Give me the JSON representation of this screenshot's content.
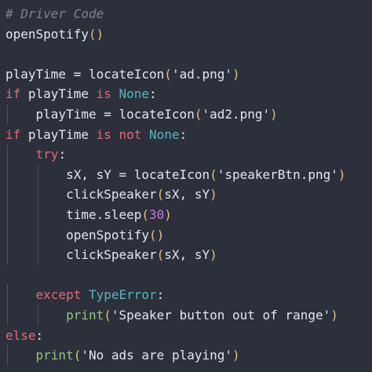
{
  "editor": {
    "lines": [
      [
        {
          "t": "# Driver Code",
          "c": "cm"
        }
      ],
      [
        {
          "t": "openSpotify",
          "c": "pu"
        },
        {
          "t": "()",
          "c": "yl"
        }
      ],
      [],
      [
        {
          "t": "playTime = locateIcon",
          "c": "pu"
        },
        {
          "t": "(",
          "c": "yl"
        },
        {
          "t": "'ad.png'",
          "c": "st"
        },
        {
          "t": ")",
          "c": "yl"
        }
      ],
      [
        {
          "t": "if",
          "c": "kw"
        },
        {
          "t": " playTime ",
          "c": "pu"
        },
        {
          "t": "is",
          "c": "kw"
        },
        {
          "t": " ",
          "c": "pu"
        },
        {
          "t": "None",
          "c": "bi"
        },
        {
          "t": ":",
          "c": "pu"
        }
      ],
      [
        {
          "t": "    playTime = locateIcon",
          "c": "pu"
        },
        {
          "t": "(",
          "c": "yl"
        },
        {
          "t": "'ad2.png'",
          "c": "st"
        },
        {
          "t": ")",
          "c": "yl"
        }
      ],
      [
        {
          "t": "if",
          "c": "kw"
        },
        {
          "t": " playTime ",
          "c": "pu"
        },
        {
          "t": "is not",
          "c": "kw"
        },
        {
          "t": " ",
          "c": "pu"
        },
        {
          "t": "None",
          "c": "bi"
        },
        {
          "t": ":",
          "c": "pu"
        }
      ],
      [
        {
          "t": "    try",
          "c": "kw"
        },
        {
          "t": ":",
          "c": "pu"
        }
      ],
      [
        {
          "t": "        sX, sY = locateIcon",
          "c": "pu"
        },
        {
          "t": "(",
          "c": "yl"
        },
        {
          "t": "'speakerBtn.png'",
          "c": "st"
        },
        {
          "t": ")",
          "c": "yl"
        }
      ],
      [
        {
          "t": "        clickSpeaker",
          "c": "pu"
        },
        {
          "t": "(",
          "c": "yl"
        },
        {
          "t": "sX, sY",
          "c": "pu"
        },
        {
          "t": ")",
          "c": "yl"
        }
      ],
      [
        {
          "t": "        time.sleep",
          "c": "pu"
        },
        {
          "t": "(",
          "c": "yl"
        },
        {
          "t": "30",
          "c": "nm"
        },
        {
          "t": ")",
          "c": "yl"
        }
      ],
      [
        {
          "t": "        openSpotify",
          "c": "pu"
        },
        {
          "t": "()",
          "c": "yl"
        }
      ],
      [
        {
          "t": "        clickSpeaker",
          "c": "pu"
        },
        {
          "t": "(",
          "c": "yl"
        },
        {
          "t": "sX, sY",
          "c": "pu"
        },
        {
          "t": ")",
          "c": "yl"
        }
      ],
      [],
      [
        {
          "t": "    except",
          "c": "kw"
        },
        {
          "t": " ",
          "c": "pu"
        },
        {
          "t": "TypeError",
          "c": "bi"
        },
        {
          "t": ":",
          "c": "pu"
        }
      ],
      [
        {
          "t": "        print",
          "c": "gr"
        },
        {
          "t": "(",
          "c": "yl"
        },
        {
          "t": "'Speaker button out of range'",
          "c": "st"
        },
        {
          "t": ")",
          "c": "yl"
        }
      ],
      [
        {
          "t": "else",
          "c": "kw"
        },
        {
          "t": ":",
          "c": "pu"
        }
      ],
      [
        {
          "t": "    print",
          "c": "gr"
        },
        {
          "t": "(",
          "c": "yl"
        },
        {
          "t": "'No ads are playing'",
          "c": "st"
        },
        {
          "t": ")",
          "c": "yl"
        }
      ]
    ]
  }
}
